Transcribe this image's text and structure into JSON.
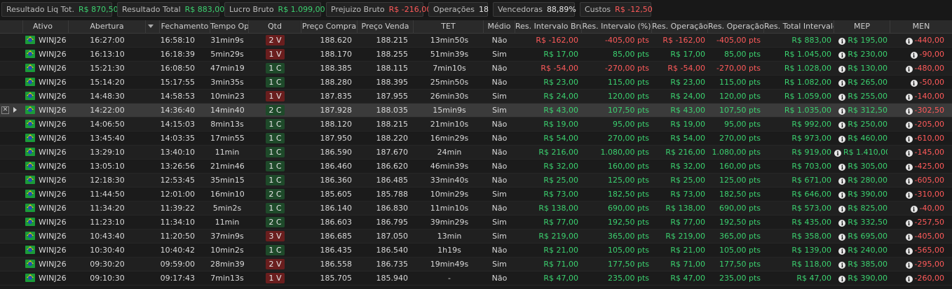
{
  "summary": [
    {
      "label": "Resultado Liq Tot.",
      "value": "R$ 870,50",
      "tone": "pos"
    },
    {
      "label": "Resultado Total",
      "value": "R$ 883,00",
      "tone": "pos"
    },
    {
      "label": "Lucro Bruto",
      "value": "R$ 1.099,00",
      "tone": "pos"
    },
    {
      "label": "Prejuizo Bruto",
      "value": "R$ -216,00",
      "tone": "neg"
    },
    {
      "label": "Operações",
      "value": "18",
      "tone": "neu"
    },
    {
      "label": "Vencedoras",
      "value": "88,89%",
      "tone": "neu"
    },
    {
      "label": "Custos",
      "value": "R$ -12,50",
      "tone": "neg"
    }
  ],
  "columns": {
    "ativo": "Ativo",
    "abertura": "Abertura",
    "fechamento": "Fechamento",
    "tempo_op": "Tempo Op",
    "qtd": "Qtd",
    "preco_compra": "Preço Compra",
    "preco_venda": "Preço Venda",
    "tet": "TET",
    "medio": "Médio",
    "res_intervalo_brl": "Res. Intervalo Bru",
    "res_intervalo_pct": "Res. Intervalo (%)",
    "res_operacao_brl": "Res. Operação",
    "res_operacao_pts": "Res. Operação (%)",
    "res_total_intervalo": "Res. Total Intervalo",
    "mep": "MEP",
    "men": "MEN"
  },
  "rows": [
    {
      "ativo": "WINJ26",
      "abertura": "16:27:00",
      "fechamento": "16:58:10",
      "tempo": "31min9s",
      "qtd": "2 V",
      "side": "V",
      "compra": "188.620",
      "venda": "188.215",
      "tet": "13min50s",
      "medio": "Não",
      "rib": "R$ -162,00",
      "rib_tone": "neg",
      "rip": "-405,00 pts",
      "rip_tone": "neg",
      "rob": "R$ -162,00",
      "rob_tone": "neg",
      "rop": "-405,00 pts",
      "rop_tone": "neg",
      "rti": "R$ 883,00",
      "mep": "R$ 195,00",
      "men": "-440,00"
    },
    {
      "ativo": "WINJ26",
      "abertura": "16:13:10",
      "fechamento": "16:18:39",
      "tempo": "5min29s",
      "qtd": "1 V",
      "side": "V",
      "compra": "188.170",
      "venda": "188.255",
      "tet": "51min39s",
      "medio": "Sim",
      "rib": "R$ 17,00",
      "rib_tone": "pos",
      "rip": "85,00 pts",
      "rip_tone": "pos",
      "rob": "R$ 17,00",
      "rob_tone": "pos",
      "rop": "85,00 pts",
      "rop_tone": "pos",
      "rti": "R$ 1.045,00",
      "mep": "R$ 230,00",
      "men": "-90,00"
    },
    {
      "ativo": "WINJ26",
      "abertura": "15:21:30",
      "fechamento": "16:08:50",
      "tempo": "47min19s",
      "qtd": "1 C",
      "side": "C",
      "compra": "188.385",
      "venda": "188.115",
      "tet": "7min10s",
      "medio": "Não",
      "rib": "R$ -54,00",
      "rib_tone": "neg",
      "rip": "-270,00 pts",
      "rip_tone": "neg",
      "rob": "R$ -54,00",
      "rob_tone": "neg",
      "rop": "-270,00 pts",
      "rop_tone": "neg",
      "rti": "R$ 1.028,00",
      "mep": "R$ 130,00",
      "men": "-480,00"
    },
    {
      "ativo": "WINJ26",
      "abertura": "15:14:20",
      "fechamento": "15:17:55",
      "tempo": "3min35s",
      "qtd": "1 C",
      "side": "C",
      "compra": "188.280",
      "venda": "188.395",
      "tet": "25min50s",
      "medio": "Não",
      "rib": "R$ 23,00",
      "rib_tone": "pos",
      "rip": "115,00 pts",
      "rip_tone": "pos",
      "rob": "R$ 23,00",
      "rob_tone": "pos",
      "rop": "115,00 pts",
      "rop_tone": "pos",
      "rti": "R$ 1.082,00",
      "mep": "R$ 265,00",
      "men": "-50,00"
    },
    {
      "ativo": "WINJ26",
      "abertura": "14:48:30",
      "fechamento": "14:58:53",
      "tempo": "10min23s",
      "qtd": "1 V",
      "side": "V",
      "compra": "187.835",
      "venda": "187.955",
      "tet": "26min30s",
      "medio": "Sim",
      "rib": "R$ 24,00",
      "rib_tone": "pos",
      "rip": "120,00 pts",
      "rip_tone": "pos",
      "rob": "R$ 24,00",
      "rob_tone": "pos",
      "rop": "120,00 pts",
      "rop_tone": "pos",
      "rti": "R$ 1.059,00",
      "mep": "R$ 255,00",
      "men": "-140,00"
    },
    {
      "ativo": "WINJ26",
      "abertura": "14:22:00",
      "fechamento": "14:36:40",
      "tempo": "14min40s",
      "qtd": "2 C",
      "side": "C",
      "compra": "187.928",
      "venda": "188.035",
      "tet": "15min9s",
      "medio": "Sim",
      "rib": "R$ 43,00",
      "rib_tone": "pos",
      "rip": "107,50 pts",
      "rip_tone": "pos",
      "rob": "R$ 43,00",
      "rob_tone": "pos",
      "rop": "107,50 pts",
      "rop_tone": "pos",
      "rti": "R$ 1.035,00",
      "mep": "R$ 312,50",
      "men": "-302,50",
      "selected": true
    },
    {
      "ativo": "WINJ26",
      "abertura": "14:06:50",
      "fechamento": "14:15:03",
      "tempo": "8min13s",
      "qtd": "1 C",
      "side": "C",
      "compra": "188.120",
      "venda": "188.215",
      "tet": "21min10s",
      "medio": "Não",
      "rib": "R$ 19,00",
      "rib_tone": "pos",
      "rip": "95,00 pts",
      "rip_tone": "pos",
      "rob": "R$ 19,00",
      "rob_tone": "pos",
      "rop": "95,00 pts",
      "rop_tone": "pos",
      "rti": "R$ 992,00",
      "mep": "R$ 250,00",
      "men": "-205,00"
    },
    {
      "ativo": "WINJ26",
      "abertura": "13:45:40",
      "fechamento": "14:03:35",
      "tempo": "17min55s",
      "qtd": "1 C",
      "side": "C",
      "compra": "187.950",
      "venda": "188.220",
      "tet": "16min29s",
      "medio": "Não",
      "rib": "R$ 54,00",
      "rib_tone": "pos",
      "rip": "270,00 pts",
      "rip_tone": "pos",
      "rob": "R$ 54,00",
      "rob_tone": "pos",
      "rop": "270,00 pts",
      "rop_tone": "pos",
      "rti": "R$ 973,00",
      "mep": "R$ 460,00",
      "men": "-610,00"
    },
    {
      "ativo": "WINJ26",
      "abertura": "13:29:10",
      "fechamento": "13:40:10",
      "tempo": "11min",
      "qtd": "1 C",
      "side": "C",
      "compra": "186.590",
      "venda": "187.670",
      "tet": "24min",
      "medio": "Não",
      "rib": "R$ 216,00",
      "rib_tone": "pos",
      "rip": "1.080,00 pts",
      "rip_tone": "pos",
      "rob": "R$ 216,00",
      "rob_tone": "pos",
      "rop": "1.080,00 pts",
      "rop_tone": "pos",
      "rti": "R$ 919,00",
      "mep": "R$ 1.410,00",
      "men": "-145,00"
    },
    {
      "ativo": "WINJ26",
      "abertura": "13:05:10",
      "fechamento": "13:26:56",
      "tempo": "21min46s",
      "qtd": "1 C",
      "side": "C",
      "compra": "186.460",
      "venda": "186.620",
      "tet": "46min39s",
      "medio": "Não",
      "rib": "R$ 32,00",
      "rib_tone": "pos",
      "rip": "160,00 pts",
      "rip_tone": "pos",
      "rob": "R$ 32,00",
      "rob_tone": "pos",
      "rop": "160,00 pts",
      "rop_tone": "pos",
      "rti": "R$ 703,00",
      "mep": "R$ 305,00",
      "men": "-425,00"
    },
    {
      "ativo": "WINJ26",
      "abertura": "12:18:30",
      "fechamento": "12:53:45",
      "tempo": "35min15s",
      "qtd": "1 C",
      "side": "C",
      "compra": "186.360",
      "venda": "186.485",
      "tet": "33min40s",
      "medio": "Não",
      "rib": "R$ 25,00",
      "rib_tone": "pos",
      "rip": "125,00 pts",
      "rip_tone": "pos",
      "rob": "R$ 25,00",
      "rob_tone": "pos",
      "rop": "125,00 pts",
      "rop_tone": "pos",
      "rti": "R$ 671,00",
      "mep": "R$ 280,00",
      "men": "-605,00"
    },
    {
      "ativo": "WINJ26",
      "abertura": "11:44:50",
      "fechamento": "12:01:00",
      "tempo": "16min10s",
      "qtd": "2 C",
      "side": "C",
      "compra": "185.605",
      "venda": "185.788",
      "tet": "10min29s",
      "medio": "Sim",
      "rib": "R$ 73,00",
      "rib_tone": "pos",
      "rip": "182,50 pts",
      "rip_tone": "pos",
      "rob": "R$ 73,00",
      "rob_tone": "pos",
      "rop": "182,50 pts",
      "rop_tone": "pos",
      "rti": "R$ 646,00",
      "mep": "R$ 390,00",
      "men": "-310,00"
    },
    {
      "ativo": "WINJ26",
      "abertura": "11:34:20",
      "fechamento": "11:39:22",
      "tempo": "5min2s",
      "qtd": "1 C",
      "side": "C",
      "compra": "186.140",
      "venda": "186.830",
      "tet": "11min10s",
      "medio": "Não",
      "rib": "R$ 138,00",
      "rib_tone": "pos",
      "rip": "690,00 pts",
      "rip_tone": "pos",
      "rob": "R$ 138,00",
      "rob_tone": "pos",
      "rop": "690,00 pts",
      "rop_tone": "pos",
      "rti": "R$ 573,00",
      "mep": "R$ 825,00",
      "men": "-40,00"
    },
    {
      "ativo": "WINJ26",
      "abertura": "11:23:10",
      "fechamento": "11:34:10",
      "tempo": "11min",
      "qtd": "2 C",
      "side": "C",
      "compra": "186.603",
      "venda": "186.795",
      "tet": "39min29s",
      "medio": "Sim",
      "rib": "R$ 77,00",
      "rib_tone": "pos",
      "rip": "192,50 pts",
      "rip_tone": "pos",
      "rob": "R$ 77,00",
      "rob_tone": "pos",
      "rop": "192,50 pts",
      "rop_tone": "pos",
      "rti": "R$ 435,00",
      "mep": "R$ 332,50",
      "men": "-257,50"
    },
    {
      "ativo": "WINJ26",
      "abertura": "10:43:40",
      "fechamento": "11:20:50",
      "tempo": "37min9s",
      "qtd": "3 V",
      "side": "V",
      "compra": "186.685",
      "venda": "187.050",
      "tet": "13min",
      "medio": "Sim",
      "rib": "R$ 219,00",
      "rib_tone": "pos",
      "rip": "365,00 pts",
      "rip_tone": "pos",
      "rob": "R$ 219,00",
      "rob_tone": "pos",
      "rop": "365,00 pts",
      "rop_tone": "pos",
      "rti": "R$ 358,00",
      "mep": "R$ 695,00",
      "men": "-405,00"
    },
    {
      "ativo": "WINJ26",
      "abertura": "10:30:40",
      "fechamento": "10:40:42",
      "tempo": "10min2s",
      "qtd": "1 C",
      "side": "C",
      "compra": "186.435",
      "venda": "186.540",
      "tet": "1h19s",
      "medio": "Não",
      "rib": "R$ 21,00",
      "rib_tone": "pos",
      "rip": "105,00 pts",
      "rip_tone": "pos",
      "rob": "R$ 21,00",
      "rob_tone": "pos",
      "rop": "105,00 pts",
      "rop_tone": "pos",
      "rti": "R$ 139,00",
      "mep": "R$ 240,00",
      "men": "-565,00"
    },
    {
      "ativo": "WINJ26",
      "abertura": "09:30:20",
      "fechamento": "09:59:00",
      "tempo": "28min39s",
      "qtd": "2 V",
      "side": "V",
      "compra": "186.558",
      "venda": "186.735",
      "tet": "19min49s",
      "medio": "Sim",
      "rib": "R$ 71,00",
      "rib_tone": "pos",
      "rip": "177,50 pts",
      "rip_tone": "pos",
      "rob": "R$ 71,00",
      "rob_tone": "pos",
      "rop": "177,50 pts",
      "rop_tone": "pos",
      "rti": "R$ 118,00",
      "mep": "R$ 385,00",
      "men": "-295,00"
    },
    {
      "ativo": "WINJ26",
      "abertura": "09:10:30",
      "fechamento": "09:17:43",
      "tempo": "7min13s",
      "qtd": "1 V",
      "side": "V",
      "compra": "185.705",
      "venda": "185.940",
      "tet": "-",
      "medio": "Não",
      "rib": "R$ 47,00",
      "rib_tone": "pos",
      "rip": "235,00 pts",
      "rip_tone": "pos",
      "rob": "R$ 47,00",
      "rob_tone": "pos",
      "rop": "235,00 pts",
      "rop_tone": "pos",
      "rti": "R$ 47,00",
      "mep": "R$ 390,00",
      "men": "-260,00"
    }
  ],
  "icons": {
    "flag": "brazil-flag-icon",
    "info": "info-icon",
    "remove": "close-icon",
    "current": "row-pointer-icon",
    "sort": "sort-desc-icon"
  },
  "colors": {
    "positive": "#3bd16f",
    "negative": "#ff5a5a",
    "sell_badge": "#6a1e1e",
    "buy_badge": "#1e4a2a"
  }
}
